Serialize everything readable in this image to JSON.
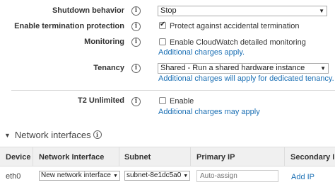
{
  "shutdown": {
    "label": "Shutdown behavior",
    "value": "Stop"
  },
  "termination": {
    "label": "Enable termination protection",
    "checkbox_label": "Protect against accidental termination",
    "checked": true
  },
  "monitoring": {
    "label": "Monitoring",
    "checkbox_label": "Enable CloudWatch detailed monitoring",
    "checked": false,
    "note": "Additional charges apply."
  },
  "tenancy": {
    "label": "Tenancy",
    "value": "Shared - Run a shared hardware instance",
    "note": "Additional charges will apply for dedicated tenancy."
  },
  "t2": {
    "label": "T2 Unlimited",
    "checkbox_label": "Enable",
    "checked": false,
    "note": "Additional charges may apply"
  },
  "info_icon_glyph": "i",
  "network": {
    "title": "Network interfaces",
    "headers": {
      "device": "Device",
      "interface": "Network Interface",
      "subnet": "Subnet",
      "primary_ip": "Primary IP",
      "secondary_ip": "Secondary IP"
    },
    "rows": [
      {
        "device": "eth0",
        "interface": "New network interface",
        "subnet": "subnet-8e1dc5a0",
        "primary_ip_placeholder": "Auto-assign",
        "secondary_action": "Add IP"
      }
    ]
  },
  "colors": {
    "link": "#1a6fb4",
    "header_bg": "#f0f0f0"
  }
}
